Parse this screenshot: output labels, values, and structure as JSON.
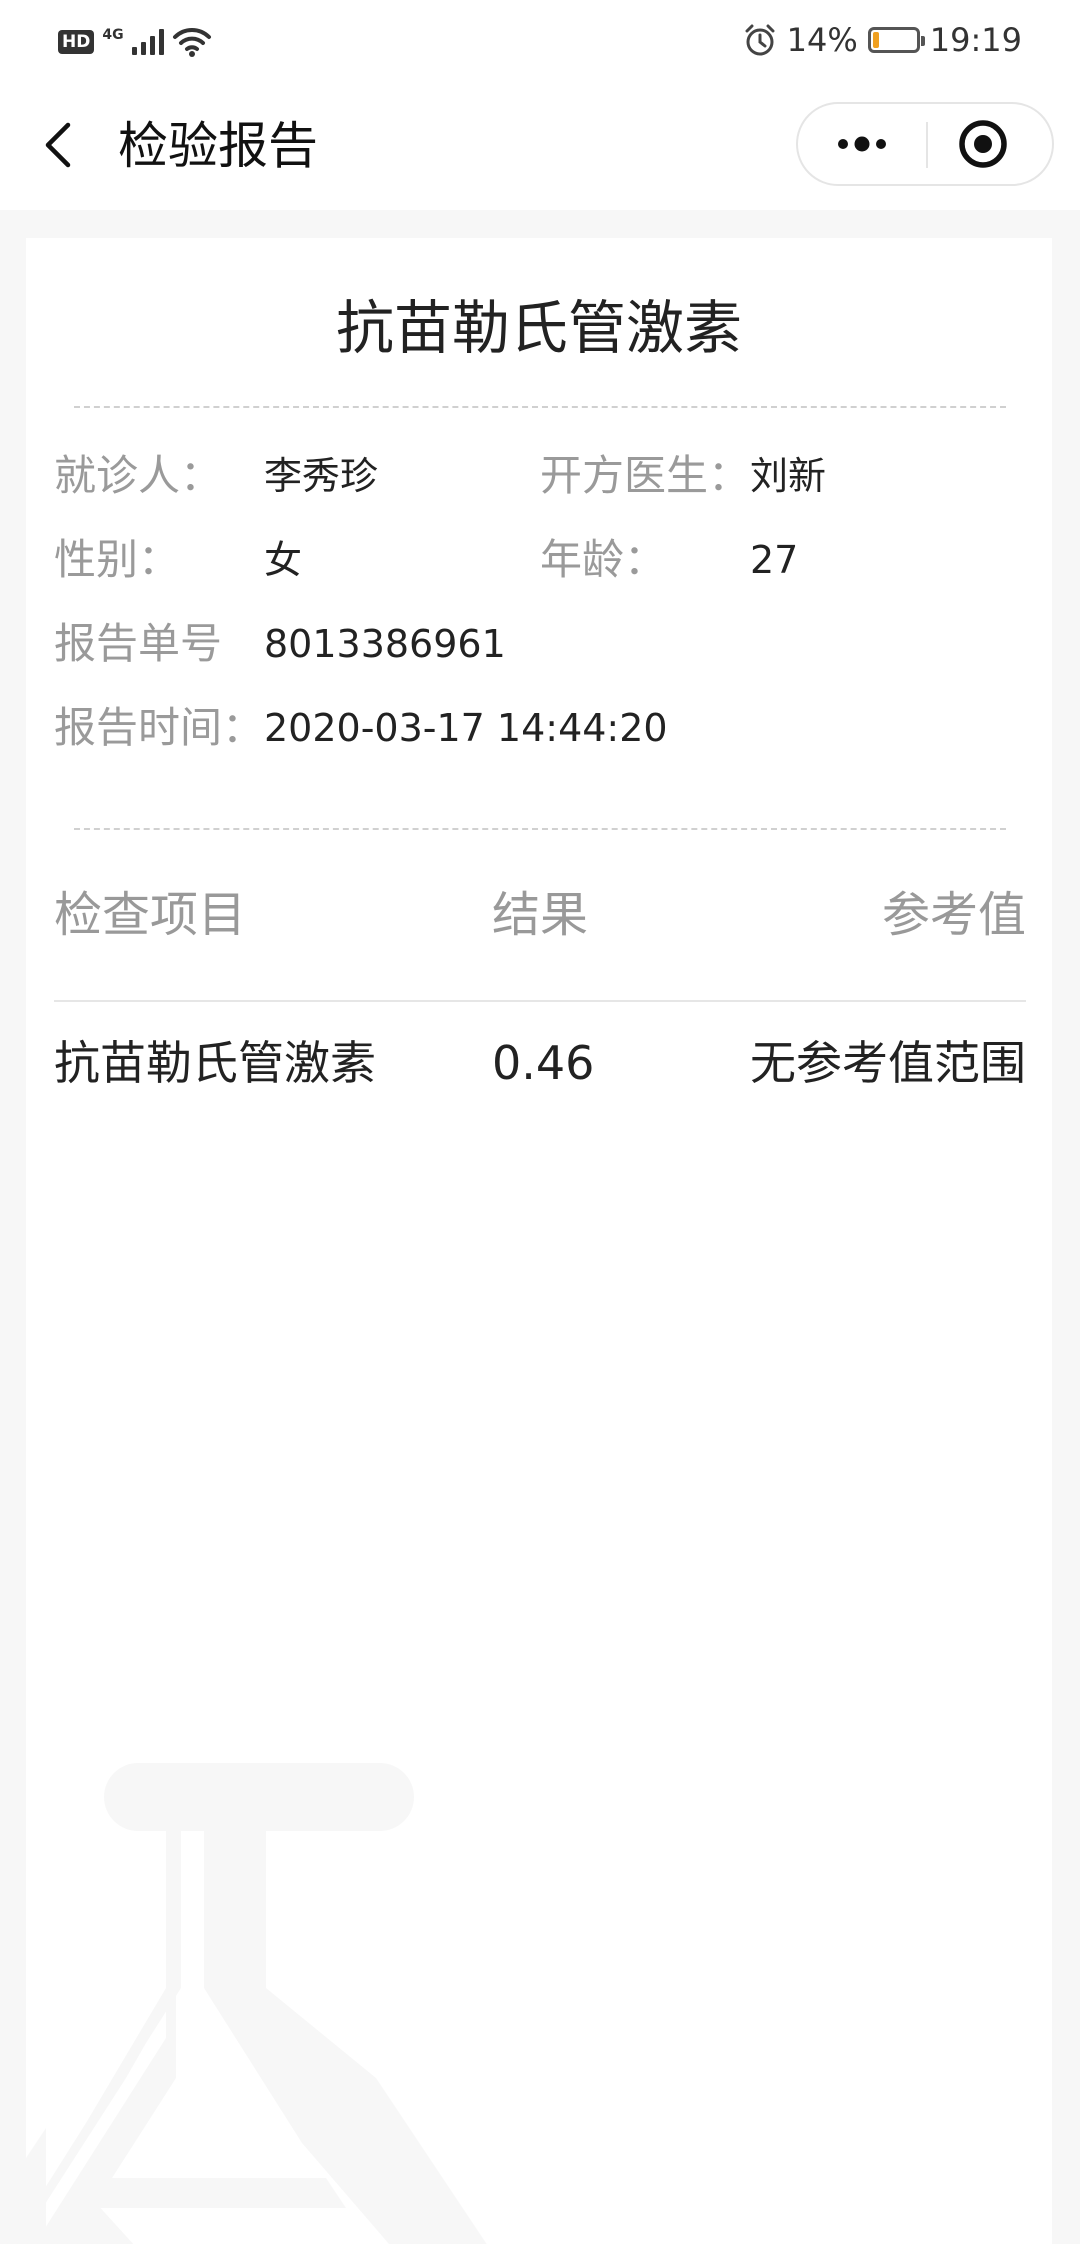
{
  "status_bar": {
    "hd": "HD",
    "network": "4G",
    "battery_text": "14%",
    "battery_level": 0.14,
    "time": "19:19"
  },
  "nav": {
    "title": "检验报告"
  },
  "report": {
    "title": "抗苗勒氏管激素",
    "info": {
      "patient_label": "就诊人：",
      "patient_value": "李秀珍",
      "doctor_label": "开方医生：",
      "doctor_value": "刘新",
      "gender_label": "性别：",
      "gender_value": "女",
      "age_label": "年龄：",
      "age_value": "27",
      "report_no_label": "报告单号",
      "report_no_value": "8013386961",
      "report_time_label": "报告时间：",
      "report_time_value": "2020-03-17 14:44:20"
    },
    "table": {
      "headers": [
        "检查项目",
        "结果",
        "参考值"
      ],
      "rows": [
        {
          "item": "抗苗勒氏管激素",
          "result": "0.46",
          "reference": "无参考值范围"
        }
      ]
    }
  },
  "colors": {
    "background": "#f7f7f7",
    "card": "#ffffff",
    "label_gray": "#9a9a9a",
    "battery_accent": "#f0a020"
  }
}
